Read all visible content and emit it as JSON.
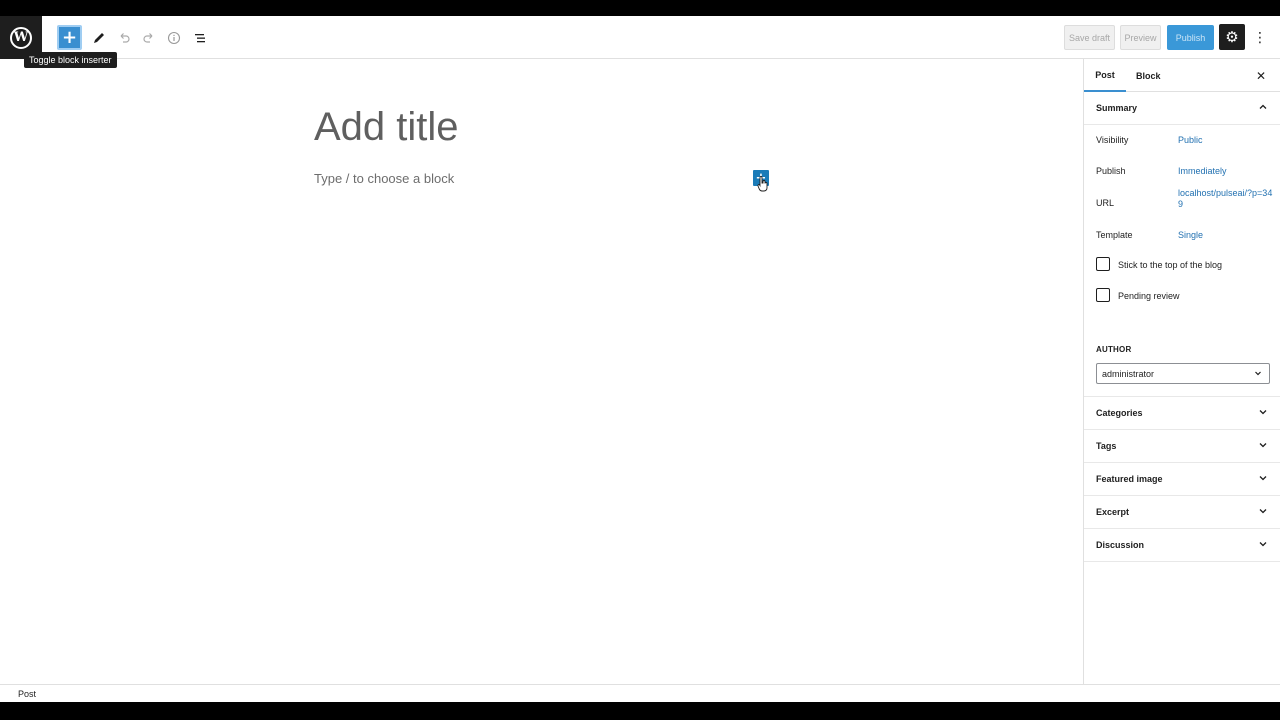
{
  "toolbar": {
    "logo_letter": "W",
    "inserter_icon": "+",
    "tooltip": "Toggle block inserter",
    "save_draft": "Save draft",
    "preview": "Preview",
    "publish": "Publish",
    "more_icon": "⋮",
    "settings_icon": "⚙",
    "icons": [
      "plus-icon",
      "pencil-icon",
      "undo-icon",
      "redo-icon",
      "info-icon",
      "list-view-icon"
    ]
  },
  "editor": {
    "title_placeholder": "Add title",
    "block_placeholder": "Type / to choose a block",
    "inline_inserter_icon": "+"
  },
  "sidebar": {
    "tabs": {
      "post": "Post",
      "block": "Block"
    },
    "close_icon": "✕",
    "summary": {
      "heading": "Summary",
      "visibility_label": "Visibility",
      "visibility_value": "Public",
      "publish_label": "Publish",
      "publish_value": "Immediately",
      "url_label": "URL",
      "url_value": "localhost/pulseai/?p=349",
      "template_label": "Template",
      "template_value": "Single",
      "sticky_label": "Stick to the top of the blog",
      "pending_label": "Pending review",
      "author_label": "AUTHOR",
      "author_value": "administrator"
    },
    "panels": [
      "Categories",
      "Tags",
      "Featured image",
      "Excerpt",
      "Discussion"
    ]
  },
  "footer": {
    "breadcrumb": "Post"
  },
  "colors": {
    "accent": "#3a8fd0",
    "link": "#2271b1",
    "dark": "#1e1e1e"
  }
}
